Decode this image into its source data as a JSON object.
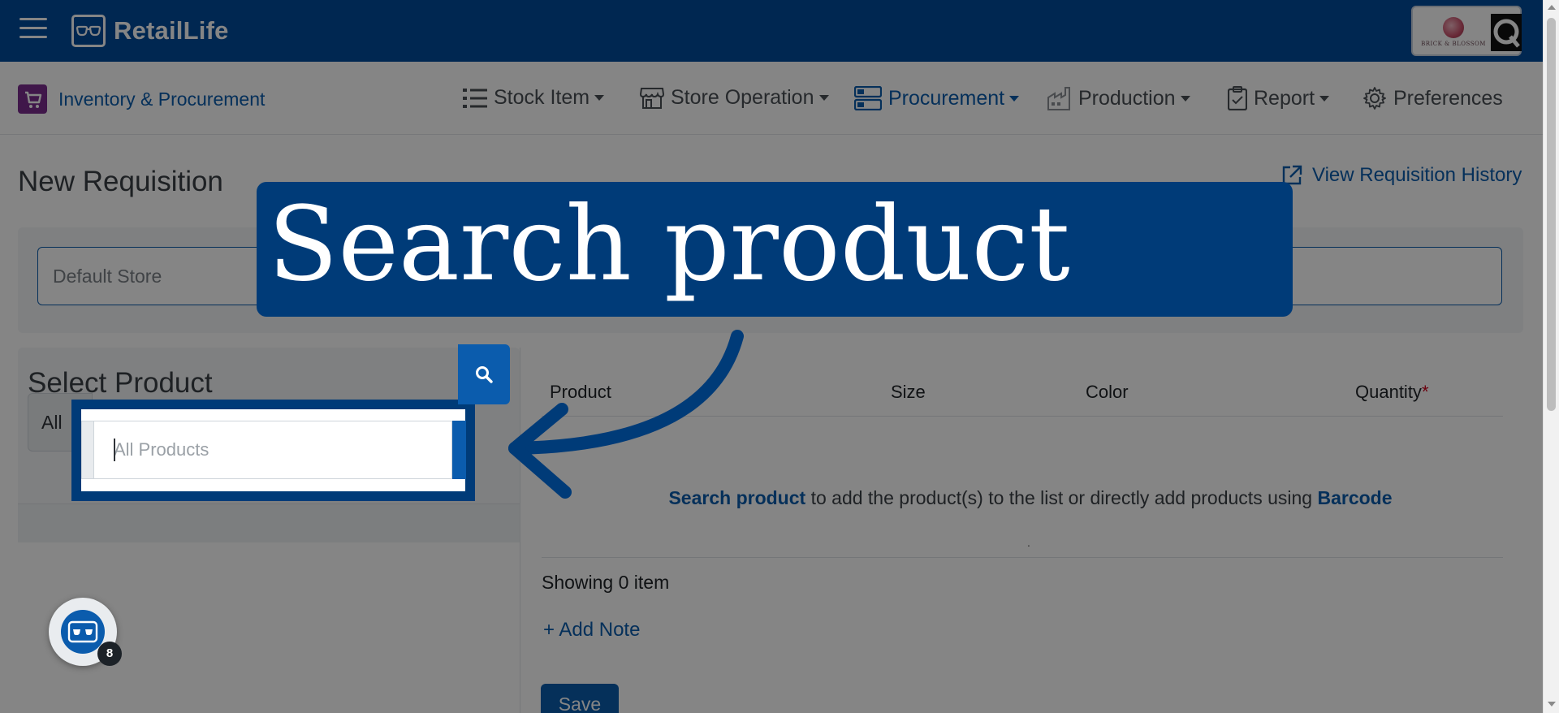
{
  "app": {
    "brand_name": "RetailLife",
    "store_badge_text": "BRICK & BLOSSOM"
  },
  "module": {
    "label": "Inventory & Procurement"
  },
  "nav": {
    "items": [
      {
        "label": "Stock Item",
        "icon": "list-icon"
      },
      {
        "label": "Store Operation",
        "icon": "store-icon"
      },
      {
        "label": "Procurement",
        "icon": "procurement-icon",
        "active": true
      },
      {
        "label": "Production",
        "icon": "factory-icon"
      },
      {
        "label": "Report",
        "icon": "clipboard-icon"
      },
      {
        "label": "Preferences",
        "icon": "gear-icon"
      }
    ]
  },
  "page": {
    "title": "New Requisition",
    "history_link": "View Requisition History",
    "store_value": "Default Store"
  },
  "select_product": {
    "title": "Select Product",
    "category_value": "All",
    "search_placeholder": "All Products"
  },
  "table": {
    "headers": {
      "product": "Product",
      "size": "Size",
      "color": "Color",
      "quantity": "Quantity",
      "required_mark": "*"
    },
    "empty": {
      "link1": "Search product",
      "middle": " to add the product(s) to the list or directly add products using ",
      "link2": "Barcode"
    },
    "dot": ".",
    "showing": "Showing 0 item",
    "add_note": "+ Add Note",
    "save_label": "Save"
  },
  "tutorial": {
    "callout_text": "Search product"
  },
  "widget": {
    "badge_count": "8"
  },
  "colors": {
    "brand_blue": "#004b9b",
    "link_blue": "#0b5cad",
    "callout_navy": "#003b78",
    "module_purple": "#7b2d8e",
    "required_red": "#d0021b"
  }
}
